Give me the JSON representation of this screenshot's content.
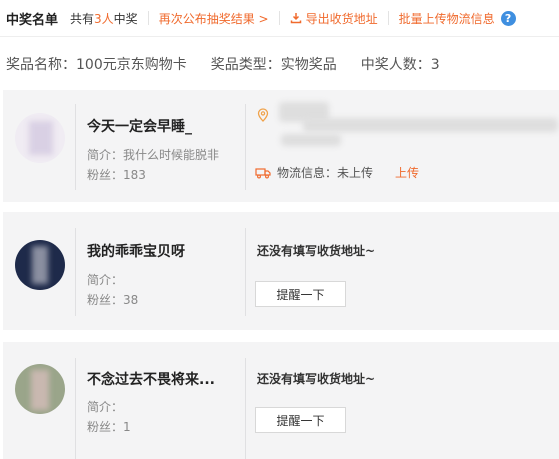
{
  "header": {
    "title": "中奖名单",
    "count_prefix": "共有",
    "count_num": "3人",
    "count_suffix": "中奖",
    "republish": "再次公布抽奖结果 >",
    "export": "导出收货地址",
    "batch_upload": "批量上传物流信息",
    "help_icon": "?"
  },
  "prize": {
    "name_label": "奖品名称：",
    "name": "100元京东购物卡",
    "type_label": "奖品类型：",
    "type": "实物奖品",
    "winners_label": "中奖人数：",
    "winners": "3"
  },
  "winners": [
    {
      "name": "今天一定会早睡_",
      "intro": "简介：我什么时候能脱非",
      "fans": "粉丝：183",
      "logistics_label": "物流信息：",
      "logistics_status": "未上传",
      "upload": "上传"
    },
    {
      "name": "我的乖乖宝贝呀",
      "intro": "简介：",
      "fans": "粉丝：38",
      "no_address": "还没有填写收货地址~",
      "remind": "提醒一下"
    },
    {
      "name": "不念过去不畏将来...",
      "intro": "简介：",
      "fans": "粉丝：1",
      "no_address": "还没有填写收货地址~",
      "remind": "提醒一下"
    }
  ],
  "colors": {
    "accent": "#f06a2d",
    "card_bg": "#f4f4f5",
    "help": "#3f8fe0"
  }
}
